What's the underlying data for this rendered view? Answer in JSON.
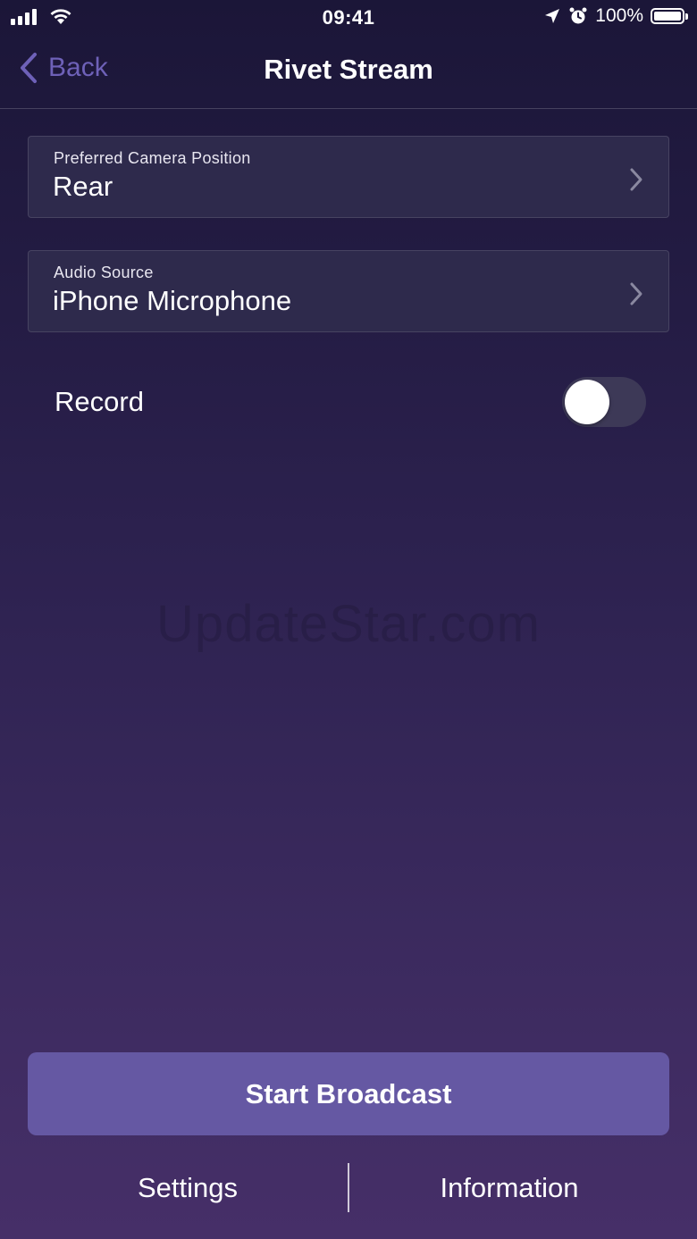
{
  "status_bar": {
    "time": "09:41",
    "battery_percent": "100%",
    "icons": [
      "signal-icon",
      "wifi-icon",
      "location-icon",
      "alarm-icon",
      "battery-icon"
    ]
  },
  "nav": {
    "back_label": "Back",
    "title": "Rivet Stream"
  },
  "options": [
    {
      "label": "Preferred Camera Position",
      "value": "Rear"
    },
    {
      "label": "Audio Source",
      "value": "iPhone Microphone"
    }
  ],
  "record": {
    "label": "Record",
    "enabled": false
  },
  "watermark": "UpdateStar.com",
  "start_button": "Start Broadcast",
  "tabs": {
    "settings": "Settings",
    "information": "Information"
  },
  "colors": {
    "accent": "#6558a3",
    "back_link": "#6e61b8",
    "card": "#2e2a4c",
    "background_top": "#1b1638",
    "background_bottom": "#462f68"
  }
}
